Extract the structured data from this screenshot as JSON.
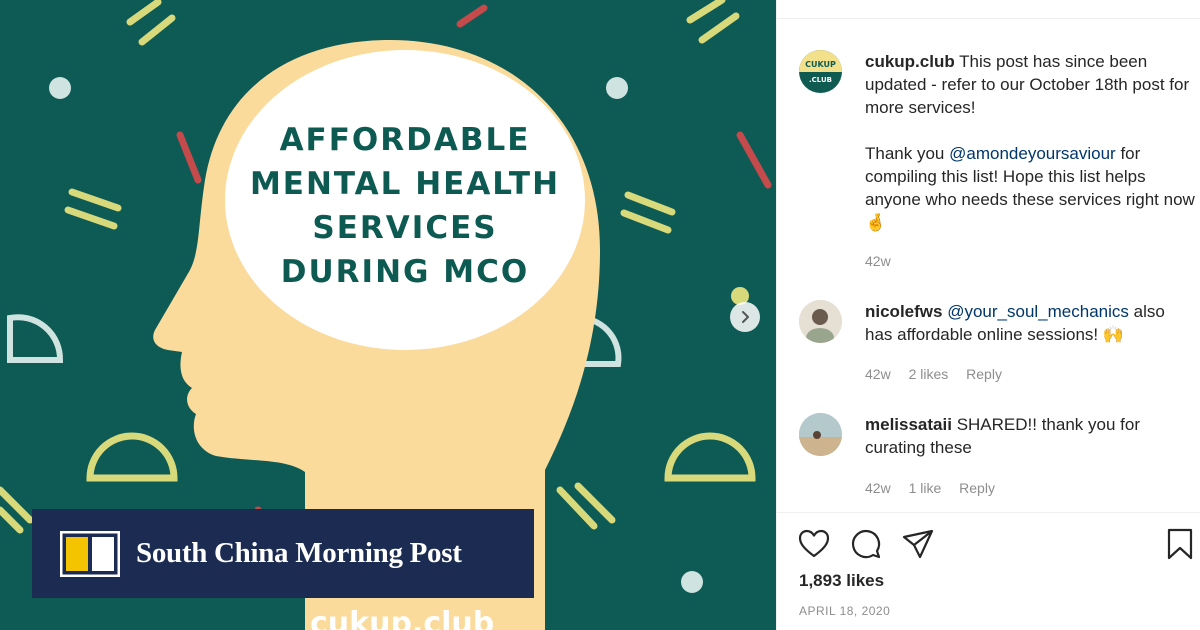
{
  "post_image": {
    "headline_lines": [
      "AFFORDABLE",
      "MENTAL HEALTH",
      "SERVICES",
      "DURING MCO"
    ],
    "watermark": "cukup.club",
    "colors": {
      "background": "#0e5a55",
      "head": "#fbdb9c",
      "bubble": "#ffffff",
      "text": "#0d5a52",
      "accent_red": "#c44a4c",
      "accent_yellow": "#d8d97a"
    },
    "next_icon": "chevron-right-icon"
  },
  "publisher": {
    "name": "South China Morning Post",
    "logo_icon": "scmp-logo-icon",
    "bg_color": "#1c2b52"
  },
  "caption": {
    "avatar_text_top": "CUKUP",
    "avatar_text_bottom": ".CLUB",
    "username": "cukup.club",
    "text_1": "This post has since been updated - refer to our October 18th post for more services!",
    "text_2a": "Thank you",
    "mention": "@amondeyoursaviour",
    "text_2b": "for compiling this list! Hope this list helps anyone who needs these services right now",
    "emoji": "🤞",
    "time": "42w"
  },
  "comments": [
    {
      "username": "nicolefws",
      "mention": "@your_soul_mechanics",
      "text": "also has affordable online sessions!",
      "emoji": "🙌",
      "time": "42w",
      "likes": "2 likes",
      "reply": "Reply"
    },
    {
      "username": "melissataii",
      "text": "SHARED!! thank you for curating these",
      "time": "42w",
      "likes": "1 like",
      "reply": "Reply"
    }
  ],
  "actions": {
    "icons": [
      "heart-icon",
      "comment-icon",
      "share-icon",
      "bookmark-icon"
    ]
  },
  "likes_count": "1,893 likes",
  "post_date": "APRIL 18, 2020"
}
